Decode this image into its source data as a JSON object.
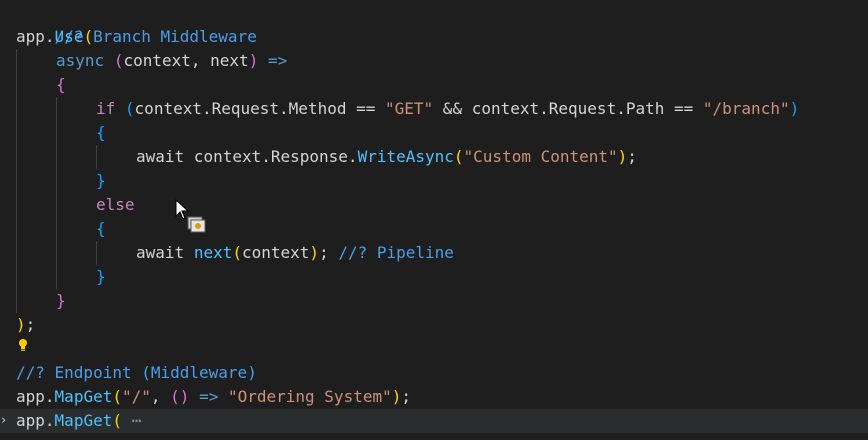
{
  "editor": {
    "lines": [
      {
        "comment": "//? Branch Middleware"
      },
      {
        "obj": "app",
        "dot": ".",
        "method": "Use",
        "open": "("
      },
      {
        "kw": "async",
        "space": " ",
        "open": "(",
        "params": "context, next",
        "close": ")",
        "arrow": " =>"
      },
      {
        "brace": "{"
      },
      {
        "kw": "if",
        "space": " ",
        "open": "(",
        "cond1": "context.Request.Method == ",
        "str1": "\"GET\"",
        "cond2": " && context.Request.Path == ",
        "str2": "\"/branch\"",
        "close": ")"
      },
      {
        "brace": "{"
      },
      {
        "kw": "await",
        "prefix": " context.Response.",
        "method": "WriteAsync",
        "open": "(",
        "str": "\"Custom Content\"",
        "close": ")",
        "semi": ";"
      },
      {
        "brace": "}"
      },
      {
        "kw": "else"
      },
      {
        "brace": "{"
      },
      {
        "kw": "await",
        "space": " ",
        "fn": "next",
        "open": "(",
        "arg": "context",
        "close": ")",
        "semi": ";",
        "space2": " ",
        "comment": "//? Pipeline"
      },
      {
        "brace": "}"
      },
      {
        "brace": "}"
      },
      {
        "close": ")",
        "semi": ";"
      },
      {
        "comment": "//? Endpoint (Middleware)"
      },
      {
        "obj": "app",
        "dot": ".",
        "method": "MapGet",
        "open": "(",
        "str1": "\"/\"",
        "comma": ", ",
        "inner_open": "(",
        "inner_close": ")",
        "arrow": " => ",
        "str2": "\"Ordering System\"",
        "close": ")",
        "semi": ";"
      },
      {
        "obj": "app",
        "dot": ".",
        "method": "MapGet",
        "open": "(",
        "space": " ",
        "ellipsis": "⋯"
      }
    ],
    "fold_arrow": "›"
  },
  "colors": {
    "background": "#1e1e1e",
    "comment": "#4a9ee8",
    "keyword": "#569cd6",
    "control": "#c586c0",
    "method": "#4fc1ff",
    "string": "#ce9178",
    "bracket_gold": "#ffd700",
    "bracket_orchid": "#da70d6",
    "bracket_blue": "#179fff",
    "lightbulb": "#ffcc00"
  },
  "icons": {
    "lightbulb": "lightbulb-icon",
    "cursor": "copy-cursor-icon",
    "fold": "chevron-right-icon"
  }
}
